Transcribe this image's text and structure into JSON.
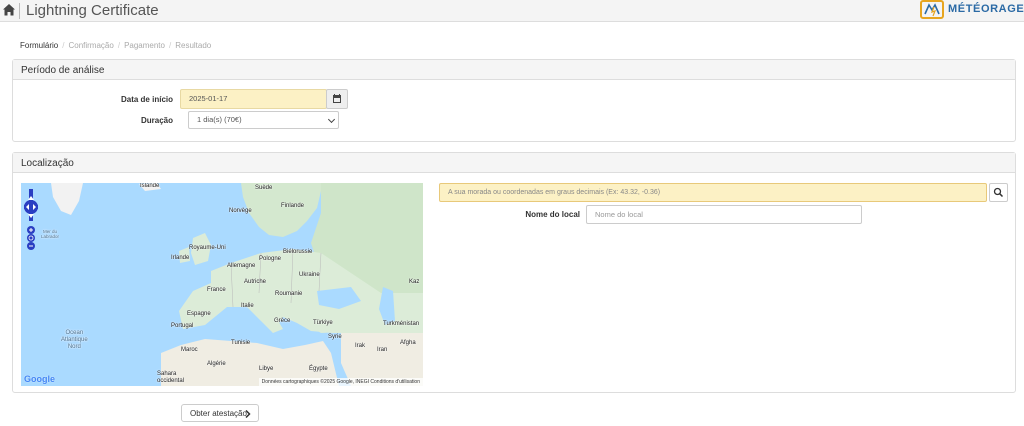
{
  "app": {
    "title": "Lightning Certificate",
    "brand": "MÉTÉORAGE",
    "accent": "#e7a51f",
    "brand_color": "#2b6aa5"
  },
  "breadcrumb": [
    "Formulário",
    "Confirmação",
    "Pagamento",
    "Resultado"
  ],
  "period": {
    "heading": "Período de análise",
    "start_label": "Data de início",
    "start_value": "2025-01-17",
    "duration_label": "Duração",
    "duration_value": "1 dia(s) (70€)"
  },
  "location": {
    "heading": "Localização",
    "search_placeholder": "A sua morada ou coordenadas em graus decimais (Ex: 43.32, -0.36)",
    "place_label": "Nome do local",
    "place_placeholder": "Nome do local"
  },
  "map": {
    "labels": {
      "islande": "Islande",
      "suede": "Suède",
      "finlande": "Finlande",
      "norvege": "Norvège",
      "ruk": "Royaume-Uni",
      "irlande": "Irlande",
      "allemagne": "Allemagne",
      "pologne": "Pologne",
      "bielorussie": "Biélorussie",
      "ukraine": "Ukraine",
      "france": "France",
      "autriche": "Autriche",
      "roumanie": "Roumanie",
      "espagne": "Espagne",
      "italie": "Italie",
      "portugal": "Portugal",
      "grece": "Grèce",
      "turkiye": "Türkiye",
      "turkmenistan": "Turkménistan",
      "kaz": "Kaz",
      "maroc": "Maroc",
      "tunisie": "Tunisie",
      "syrie": "Syrie",
      "irak": "Irak",
      "afgh": "Afgha",
      "iran": "Iran",
      "algerie": "Algérie",
      "libye": "Libye",
      "egypte": "Égypte",
      "sahara": "Sahara\noccidental",
      "ocean": "Ocean\nAtlantique\nNord",
      "labrador": "Mer du\nLabrador"
    },
    "google": "Google",
    "attribution": "Données cartographiques ©2025 Google, INEGI   Conditions d'utilisation"
  },
  "actions": {
    "submit_label": "Obter atestação"
  }
}
